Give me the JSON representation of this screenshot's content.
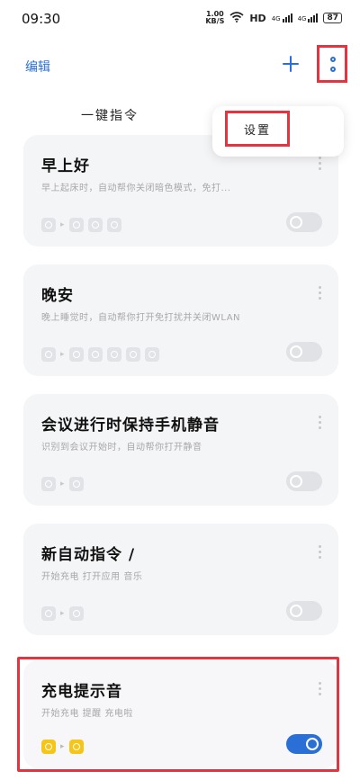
{
  "status_bar": {
    "time": "09:30",
    "net_speed_value": "1.00",
    "net_speed_unit": "KB/S",
    "hd": "HD",
    "signal1": "4G",
    "signal2": "4G",
    "battery": "87"
  },
  "toolbar": {
    "edit_label": "编辑"
  },
  "section": {
    "title": "一键指令"
  },
  "menu": {
    "items": [
      {
        "label": "设置"
      }
    ]
  },
  "cards": [
    {
      "title": "早上好",
      "desc": "早上起床时，自动帮你关闭暗色模式，免打...",
      "enabled": false
    },
    {
      "title": "晚安",
      "desc": "晚上睡觉时，自动帮你打开免打扰并关闭WLAN",
      "enabled": false
    },
    {
      "title": "会议进行时保持手机静音",
      "desc": "识别到会议开始时，自动帮你打开静音",
      "enabled": false
    },
    {
      "title": "新自动指令 /",
      "desc": "开始充电  打开应用 音乐",
      "enabled": false
    },
    {
      "title": "充电提示音",
      "desc": "开始充电  提醒 充电啦",
      "enabled": true
    }
  ],
  "colors": {
    "accent": "#2a6fd6",
    "highlight": "#e3343f",
    "active_chip": "#f5c518"
  }
}
